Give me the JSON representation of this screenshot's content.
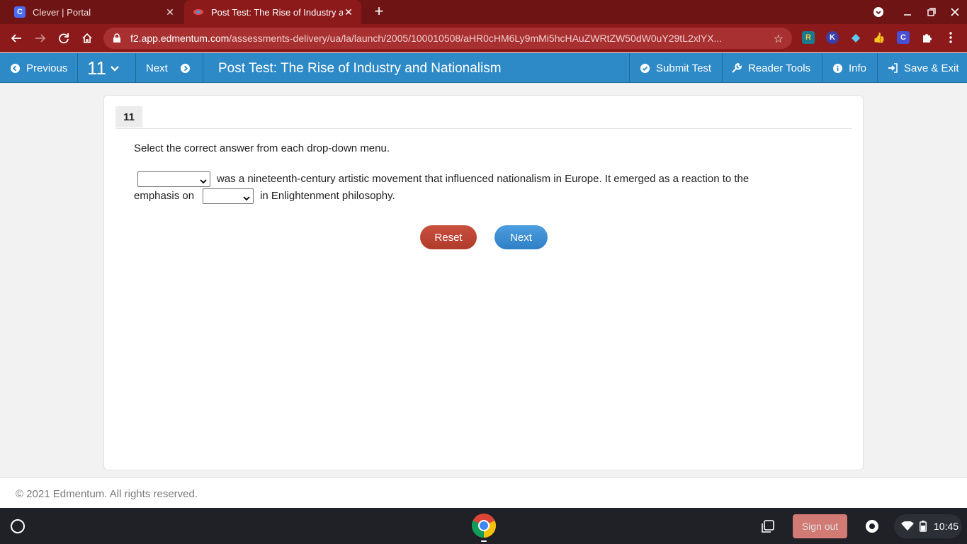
{
  "browser": {
    "tabs": [
      {
        "title": "Clever | Portal",
        "icon": "clever-icon"
      },
      {
        "title": "Post Test: The Rise of Industry and Nationalism",
        "icon": "edmentum-icon"
      }
    ],
    "url_host": "f2.app.edmentum.com",
    "url_path": "/assessments-delivery/ua/la/launch/2005/100010508/aHR0cHM6Ly9mMi5hcHAuZWRtZW50dW0uY29tL2xlYX...",
    "extensions": [
      "R",
      "K",
      "◆",
      "👍",
      "C"
    ]
  },
  "appbar": {
    "previous_label": "Previous",
    "question_number": "11",
    "next_label": "Next",
    "title": "Post Test: The Rise of Industry and Nationalism",
    "submit_label": "Submit Test",
    "reader_tools_label": "Reader Tools",
    "info_label": "Info",
    "save_exit_label": "Save & Exit",
    "accent_color": "#2d8ac7"
  },
  "question": {
    "number": "11",
    "instruction": "Select the correct answer from each drop-down menu.",
    "sentence_part1": "was a nineteenth-century artistic movement that influenced nationalism in Europe. It emerged as a reaction to the",
    "sentence_part2_prefix": "emphasis on",
    "sentence_part2_suffix": "in Enlightenment philosophy.",
    "dropdown1_value": "",
    "dropdown2_value": "",
    "reset_label": "Reset",
    "next_label": "Next"
  },
  "footer": {
    "copyright": "© 2021 Edmentum. All rights reserved."
  },
  "shelf": {
    "sign_out_label": "Sign out",
    "time": "10:45"
  }
}
